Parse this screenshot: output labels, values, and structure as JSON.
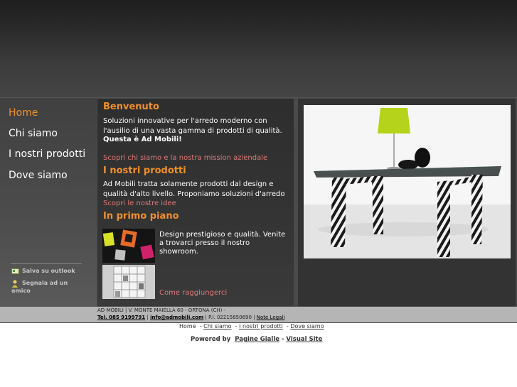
{
  "nav": {
    "items": [
      {
        "label": "Home"
      },
      {
        "label": "Chi siamo"
      },
      {
        "label": "I nostri prodotti"
      },
      {
        "label": "Dove siamo"
      }
    ],
    "utility": {
      "bookmark_label": "Salva su outlook",
      "share_label": "Segnala ad un amico"
    }
  },
  "welcome": {
    "title": "Benvenuto",
    "text": "Soluzioni innovative per l'arredo moderno con l'ausilio di una vasta gamma di prodotti di qualità.",
    "tagline": "Questa è Ad Mobili!",
    "link": "Scopri chi siamo e la nostra mission aziendale"
  },
  "products": {
    "title": "I nostri prodotti",
    "text": "Ad Mobili tratta solamente prodotti dal design e qualità d'alto livello. Proponiamo soluzioni d'arredo per",
    "link": "Scopri le nostre idee"
  },
  "featured": {
    "title": "In primo piano",
    "text": "Design prestigioso e qualità. Venite a trovarci presso il nostro showroom.",
    "link": "Come raggiungerci"
  },
  "footer": {
    "address_line1": "AD MOBILI | V. MONTE MAIELLA 60 - ORTONA (CH) -",
    "phone": "Tel. 085 9199791",
    "email": "info@admobili.com",
    "vat": "| P.I. 02215850690 |",
    "legal": "Note Legali",
    "links": [
      "Home",
      "Chi siamo",
      "I nostri prodotti",
      "Dove siamo"
    ],
    "powered_prefix": "Powered by",
    "powered_1": "Pagine Gialle",
    "powered_2": "Visual Site"
  },
  "colors": {
    "accent": "#f0902a",
    "link": "#e07878",
    "chair_green": "#b5d31a"
  }
}
